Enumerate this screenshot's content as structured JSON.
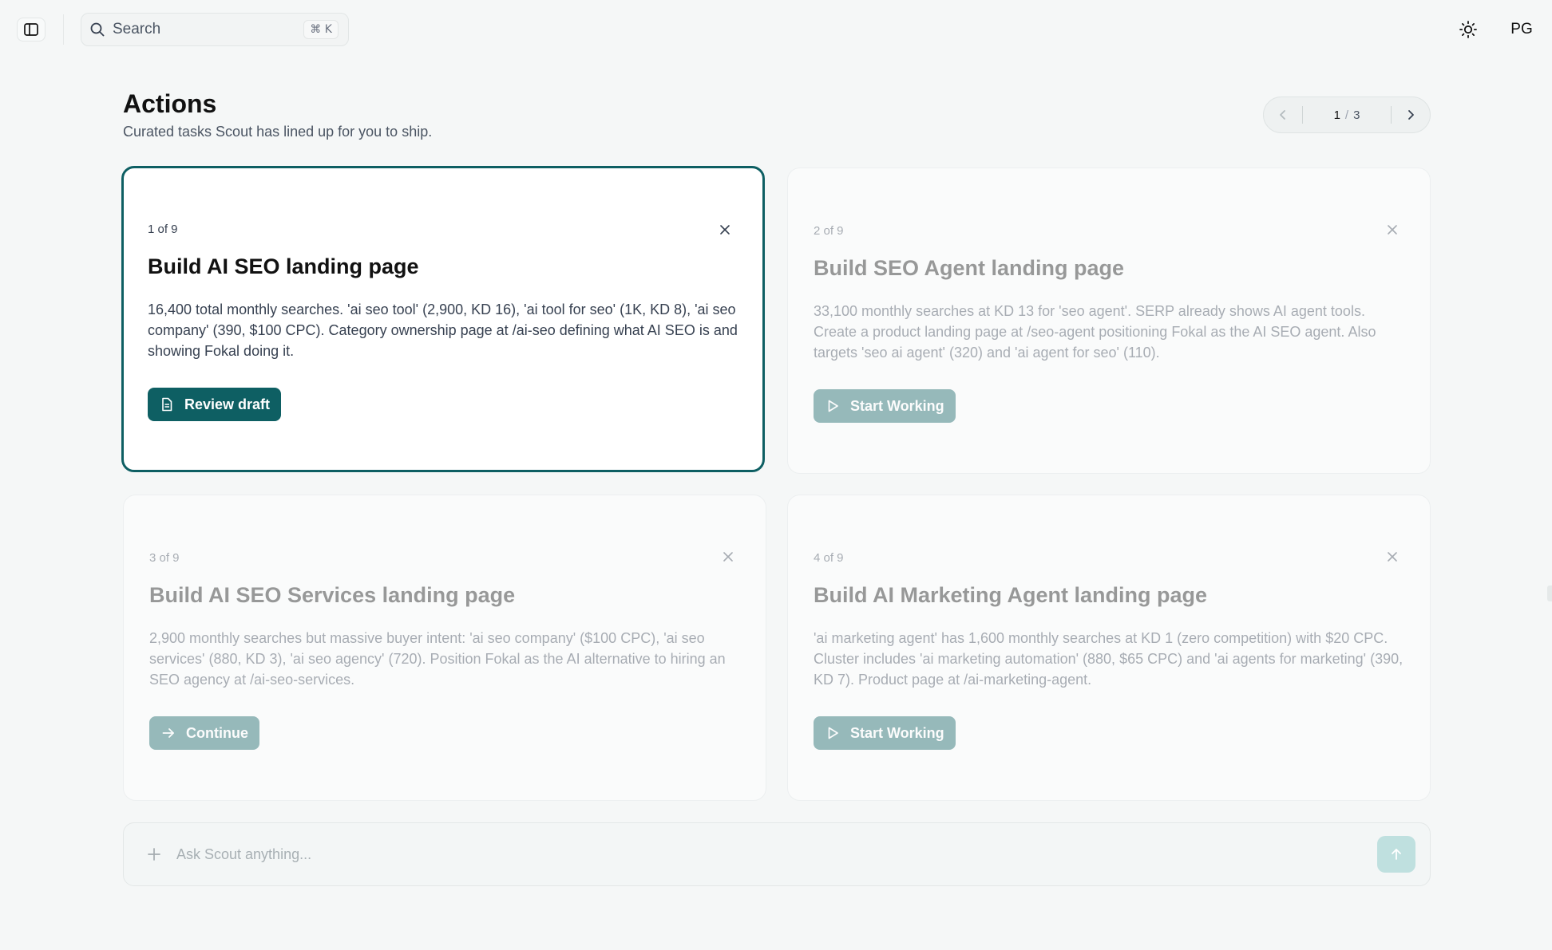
{
  "topbar": {
    "search_label": "Search",
    "search_shortcut": "⌘ K",
    "avatar_initials": "PG"
  },
  "page": {
    "title": "Actions",
    "subtitle": "Curated tasks Scout has lined up for you to ship."
  },
  "pager": {
    "current": "1",
    "separator": "/",
    "total": "3"
  },
  "cards": [
    {
      "counter": "1 of 9",
      "title": "Build AI SEO landing page",
      "description": "16,400 total monthly searches. 'ai seo tool' (2,900, KD 16), 'ai tool for seo' (1K, KD 8), 'ai seo company' (390, $100 CPC). Category ownership page at /ai-seo defining what AI SEO is and showing Fokal doing it.",
      "button_label": "Review draft",
      "button_icon": "document-icon"
    },
    {
      "counter": "2 of 9",
      "title": "Build SEO Agent landing page",
      "description": "33,100 monthly searches at KD 13 for 'seo agent'. SERP already shows AI agent tools. Create a product landing page at /seo-agent positioning Fokal as the AI SEO agent. Also targets 'seo ai agent' (320) and 'ai agent for seo' (110).",
      "button_label": "Start Working",
      "button_icon": "play-icon"
    },
    {
      "counter": "3 of 9",
      "title": "Build AI SEO Services landing page",
      "description": "2,900 monthly searches but massive buyer intent: 'ai seo company' ($100 CPC), 'ai seo services' (880, KD 3), 'ai seo agency' (720). Position Fokal as the AI alternative to hiring an SEO agency at /ai-seo-services.",
      "button_label": "Continue",
      "button_icon": "arrow-right-icon"
    },
    {
      "counter": "4 of 9",
      "title": "Build AI Marketing Agent landing page",
      "description": "'ai marketing agent' has 1,600 monthly searches at KD 1 (zero competition) with $20 CPC. Cluster includes 'ai marketing automation' (880, $65 CPC) and 'ai agents for marketing' (390, KD 7). Product page at /ai-marketing-agent.",
      "button_label": "Start Working",
      "button_icon": "play-icon"
    }
  ],
  "composer": {
    "placeholder": "Ask Scout anything..."
  },
  "colors": {
    "accent": "#0e5f63",
    "background": "#f5f7f7",
    "send_button": "#bfe0df"
  }
}
